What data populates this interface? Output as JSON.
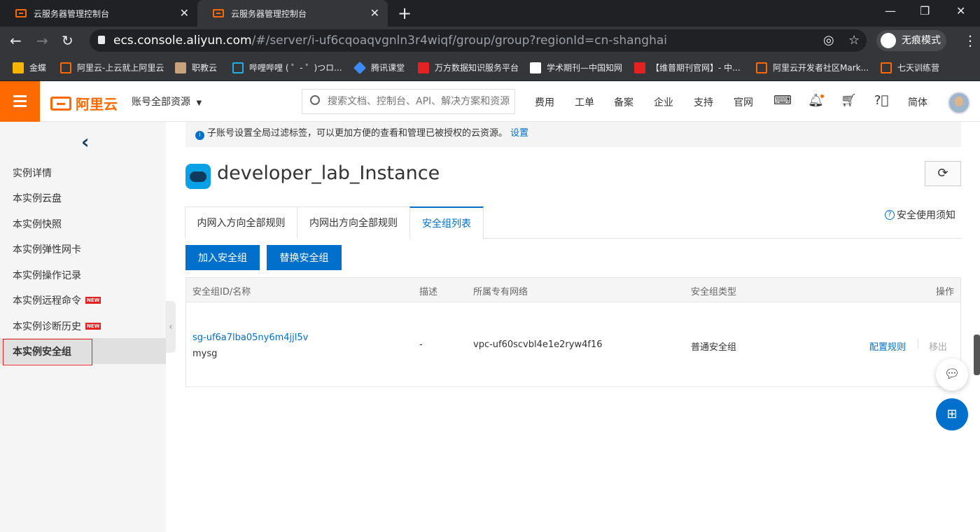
{
  "browser": {
    "tabs": [
      {
        "title": "云服务器管理控制台",
        "active": false
      },
      {
        "title": "云服务器管理控制台",
        "active": true
      }
    ],
    "url_host": "ecs.console.aliyun.com",
    "url_path": "/#/server/i-uf6cqoaqvgnln3r4wiqf/group/group?regionId=cn-shanghai",
    "incognito_label": "无痕模式",
    "bookmarks": [
      {
        "label": "金蝶",
        "color": "#f6b400"
      },
      {
        "label": "阿里云-上云就上阿里云",
        "color": "#ff6a00"
      },
      {
        "label": "职教云",
        "color": "#c8a27a"
      },
      {
        "label": "哔哩哔哩 ( ゜- ゜)つロ...",
        "color": "#23ade5"
      },
      {
        "label": "腾讯课堂",
        "color": "#3d8af7"
      },
      {
        "label": "万方数据知识服务平台",
        "color": "#e42222"
      },
      {
        "label": "学术期刊—中国知网",
        "color": "#ffffff"
      },
      {
        "label": "【维普期刊官网】- 中...",
        "color": "#e42222"
      },
      {
        "label": "阿里云开发者社区Mark...",
        "color": "#ff6a00"
      },
      {
        "label": "七天训练营",
        "color": "#ff6a00"
      }
    ]
  },
  "header": {
    "logo_text": "阿里云",
    "account_label": "账号全部资源",
    "search_placeholder": "搜索文档、控制台、API、解决方案和资源",
    "nav": [
      "费用",
      "工单",
      "备案",
      "企业",
      "支持",
      "官网"
    ],
    "lang": "简体"
  },
  "sidebar": {
    "items": [
      {
        "label": "实例详情",
        "new": false
      },
      {
        "label": "本实例云盘",
        "new": false
      },
      {
        "label": "本实例快照",
        "new": false
      },
      {
        "label": "本实例弹性网卡",
        "new": false
      },
      {
        "label": "本实例操作记录",
        "new": false
      },
      {
        "label": "本实例远程命令",
        "new": true
      },
      {
        "label": "本实例诊断历史",
        "new": true
      },
      {
        "label": "本实例安全组",
        "new": false,
        "active": true
      }
    ],
    "new_badge": "NEW"
  },
  "notice": {
    "text": "子账号设置全局过滤标签，可以更加方便的查看和管理已被授权的云资源。",
    "link": "设置"
  },
  "instance": {
    "name": "developer_lab_Instance"
  },
  "content_tabs": [
    {
      "label": "内网入方向全部规则",
      "active": false
    },
    {
      "label": "内网出方向全部规则",
      "active": false
    },
    {
      "label": "安全组列表",
      "active": true
    }
  ],
  "guide_link": "安全使用须知",
  "buttons": {
    "join": "加入安全组",
    "replace": "替换安全组"
  },
  "table": {
    "headers": [
      "安全组ID/名称",
      "描述",
      "所属专有网络",
      "安全组类型",
      "操作"
    ],
    "rows": [
      {
        "id": "sg-uf6a7lba05ny6m4jjl5v",
        "name": "mysg",
        "description": "-",
        "vpc": "vpc-uf60scvbl4e1e2ryw4f16",
        "type": "普通安全组",
        "action_config": "配置规则",
        "action_remove": "移出"
      }
    ]
  },
  "colors": {
    "brand_orange": "#ff6a00",
    "primary_blue": "#0070cc",
    "alert_red": "#e42222"
  }
}
